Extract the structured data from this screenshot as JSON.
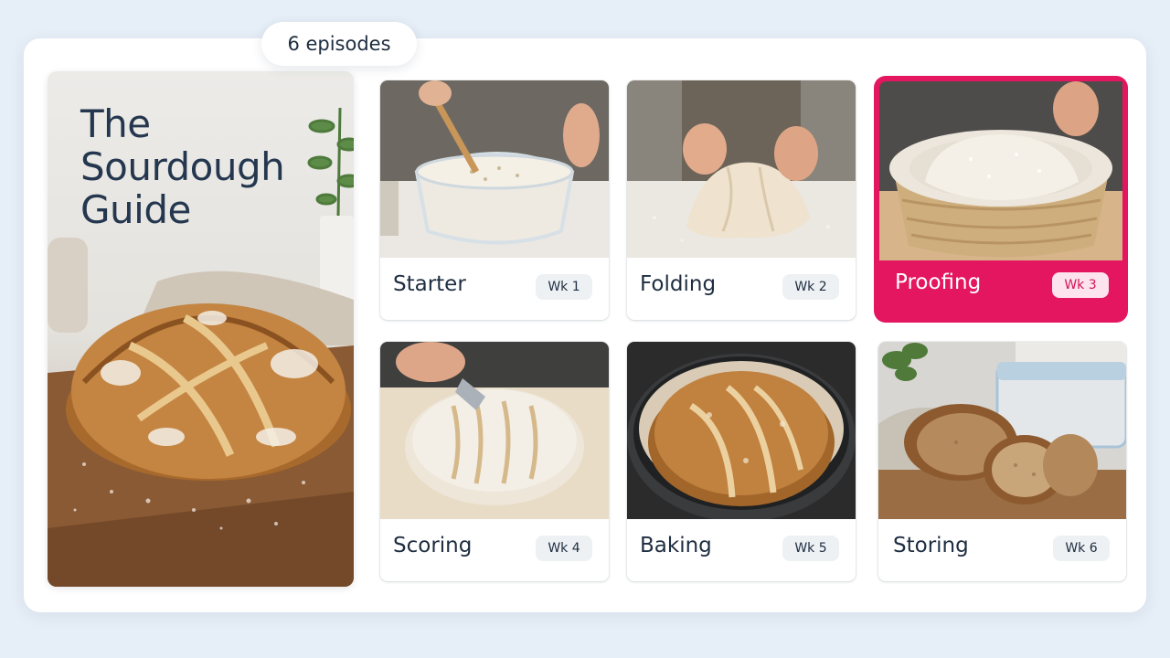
{
  "header": {
    "episode_count": "6 episodes"
  },
  "hero": {
    "title": "The\nSourdough\nGuide"
  },
  "episodes": [
    {
      "title": "Starter",
      "week": "Wk 1",
      "icon": "mixing-bowl-photo"
    },
    {
      "title": "Folding",
      "week": "Wk 2",
      "icon": "dough-folding-photo"
    },
    {
      "title": "Proofing",
      "week": "Wk 3",
      "icon": "proofing-basket-photo",
      "selected": true
    },
    {
      "title": "Scoring",
      "week": "Wk 4",
      "icon": "scoring-blade-photo"
    },
    {
      "title": "Baking",
      "week": "Wk 5",
      "icon": "dutch-oven-photo"
    },
    {
      "title": "Storing",
      "week": "Wk 6",
      "icon": "sliced-loaf-photo"
    }
  ],
  "colors": {
    "accent": "#e3165f",
    "text": "#1e2d40",
    "background": "#e6eef7"
  }
}
